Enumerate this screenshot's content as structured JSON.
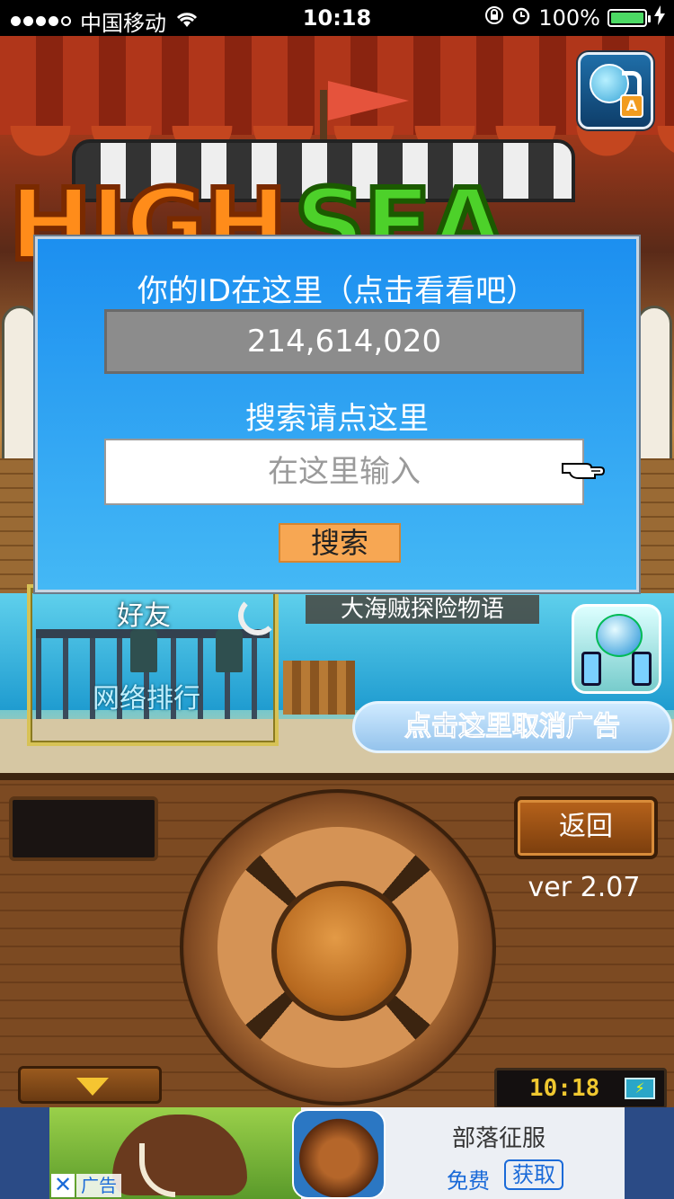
{
  "status_bar": {
    "carrier": "中国移动",
    "time": "10:18",
    "battery": "100%"
  },
  "game": {
    "logo_left": "HIGH",
    "logo_right": "SEA",
    "friends_label": "好友",
    "ranking_label": "网络排行",
    "game_title": "大海贼探险物语",
    "remove_ads_label": "点击这里取消广告",
    "lang_badge": "A"
  },
  "dialog": {
    "heading": "你的ID在这里（点击看看吧）",
    "player_id": "214,614,020",
    "search_heading": "搜索请点这里",
    "search_placeholder": "在这里输入",
    "search_button": "搜索"
  },
  "panel": {
    "back_button": "返回",
    "version": "ver 2.07",
    "clock": "10:18"
  },
  "ad": {
    "app_name": "部落征服",
    "free_label": "免费",
    "get_button": "获取",
    "ad_label": "广告",
    "close_label": "✕"
  },
  "colors": {
    "dialog_top": "#1c8ff0",
    "dialog_bottom": "#44b8f5",
    "search_button": "#f7a753",
    "ad_link": "#1a6ad8"
  }
}
